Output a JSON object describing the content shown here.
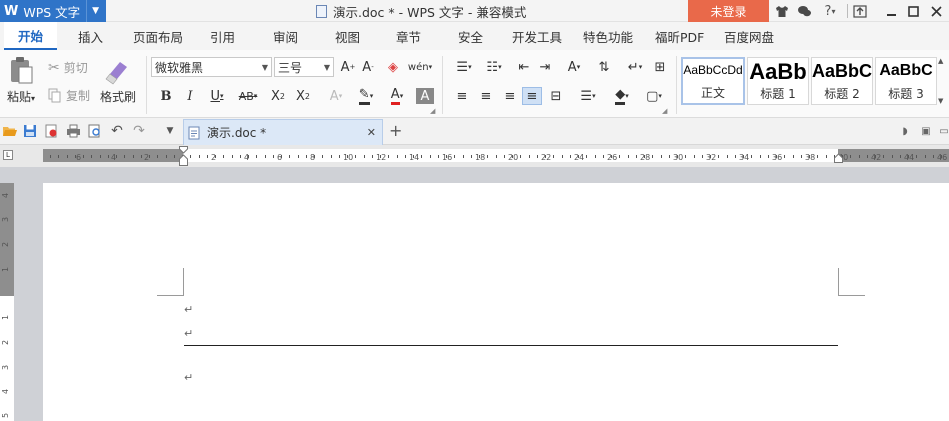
{
  "titlebar": {
    "app_logo": "W",
    "app_name": "WPS 文字",
    "doc_title": "演示.doc * - WPS 文字 - 兼容模式",
    "login_label": "未登录",
    "icons": [
      "shirt-icon",
      "chat-icon",
      "help-icon",
      "upload-icon",
      "minimize-icon",
      "maximize-icon",
      "close-icon"
    ]
  },
  "tabs": [
    "开始",
    "插入",
    "页面布局",
    "引用",
    "审阅",
    "视图",
    "章节",
    "安全",
    "开发工具",
    "特色功能",
    "福昕PDF",
    "百度网盘"
  ],
  "ribbon": {
    "paste": "粘贴",
    "cut": "剪切",
    "copy": "复制",
    "format_painter": "格式刷",
    "font_name": "微软雅黑",
    "font_size": "三号",
    "styles": [
      {
        "sample": "AaBbCcDd",
        "label": "正文"
      },
      {
        "sample": "AaBb",
        "label": "标题 1"
      },
      {
        "sample": "AaBbC",
        "label": "标题 2"
      },
      {
        "sample": "AaBbC",
        "label": "标题 3"
      }
    ]
  },
  "doc_tab": {
    "label": "演示.doc *",
    "add": "+"
  },
  "ruler": {
    "ticks": [
      "6",
      "4",
      "2",
      "2",
      "4",
      "6",
      "8",
      "10",
      "12",
      "14",
      "16",
      "18",
      "20",
      "22",
      "24",
      "26",
      "28",
      "30",
      "32",
      "34",
      "36",
      "38",
      "40",
      "42",
      "44",
      "46"
    ],
    "vticks": [
      "4",
      "3",
      "2",
      "1",
      "1",
      "2",
      "3",
      "4",
      "5"
    ]
  },
  "colors": {
    "accent": "#1f67c2",
    "wps_blue": "#2f74c8",
    "login": "#e9694a"
  }
}
